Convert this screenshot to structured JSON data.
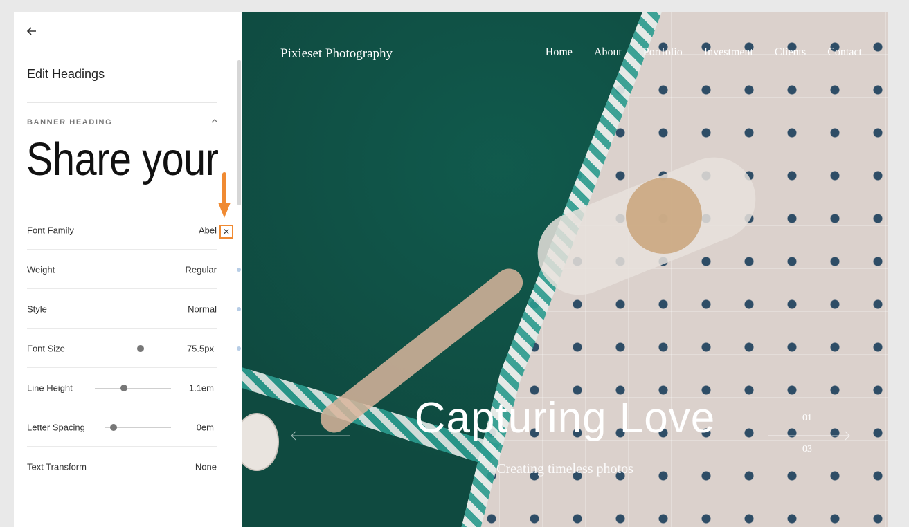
{
  "panel": {
    "title": "Edit Headings",
    "section_label": "BANNER HEADING",
    "preview_text": "Share your",
    "rows": [
      {
        "label": "Font Family",
        "value": "Abel"
      },
      {
        "label": "Weight",
        "value": "Regular"
      },
      {
        "label": "Style",
        "value": "Normal"
      },
      {
        "label": "Font Size",
        "value": "75.5px",
        "slider": 0.6
      },
      {
        "label": "Line Height",
        "value": "1.1em",
        "slider": 0.38
      },
      {
        "label": "Letter Spacing",
        "value": "0em",
        "slider": 0.14
      },
      {
        "label": "Text Transform",
        "value": "None"
      }
    ],
    "clear_glyph": "✕"
  },
  "hero": {
    "brand": "Pixieset Photography",
    "nav": [
      "Home",
      "About",
      "Portfolio",
      "Investment",
      "Clients",
      "Contact"
    ],
    "heading": "Capturing Love",
    "subheading": "Creating timeless photos",
    "counter_current": "01",
    "counter_total": "03"
  },
  "colors": {
    "accent_arrow": "#f08a32",
    "pool": "#0f4a40",
    "tile_star": "#2e4d66"
  }
}
